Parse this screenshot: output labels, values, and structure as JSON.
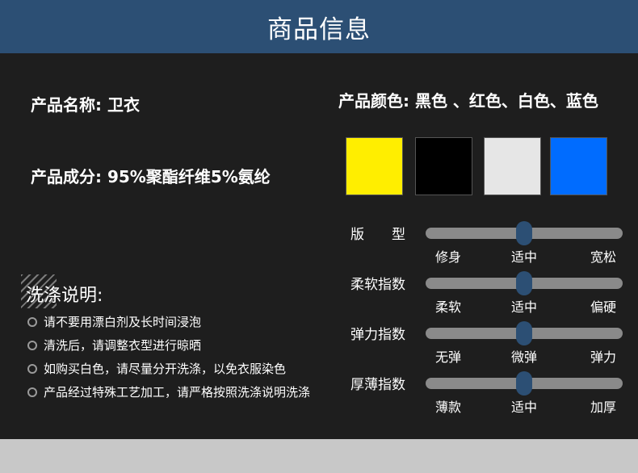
{
  "header": {
    "title": "商品信息"
  },
  "product": {
    "name": "产品名称:   卫衣",
    "composition": "产品成分: 95%聚酯纤维5%氨纶",
    "colors_label": "产品颜色: 黑色 、红色、白色、蓝色",
    "swatches": [
      {
        "name": "yellow",
        "color": "#ffee00"
      },
      {
        "name": "black",
        "color": "#000000"
      },
      {
        "name": "white",
        "color": "#e6e6e6"
      },
      {
        "name": "blue",
        "color": "#006cff"
      }
    ]
  },
  "wash": {
    "title": "洗涤说明",
    "items": [
      "请不要用漂白剂及长时间浸泡",
      "清洗后，请调整衣型进行晾晒",
      "如购买白色，请尽量分开洗涤，以免衣服染色",
      "产品经过特殊工艺加工，请严格按照洗涤说明洗涤"
    ]
  },
  "sliders": [
    {
      "label": "版　　型",
      "ticks": [
        "修身",
        "适中",
        "宽松"
      ],
      "value": 0.5
    },
    {
      "label": "柔软指数",
      "ticks": [
        "柔软",
        "适中",
        "偏硬"
      ],
      "value": 0.5
    },
    {
      "label": "弹力指数",
      "ticks": [
        "无弹",
        "微弹",
        "弹力"
      ],
      "value": 0.5
    },
    {
      "label": "厚薄指数",
      "ticks": [
        "薄款",
        "适中",
        "加厚"
      ],
      "value": 0.5
    }
  ],
  "colors": {
    "header_bg": "#2c4f74",
    "panel_bg": "#1e1e1e",
    "thumb": "#2c4f74",
    "track": "#8a8a8a"
  }
}
